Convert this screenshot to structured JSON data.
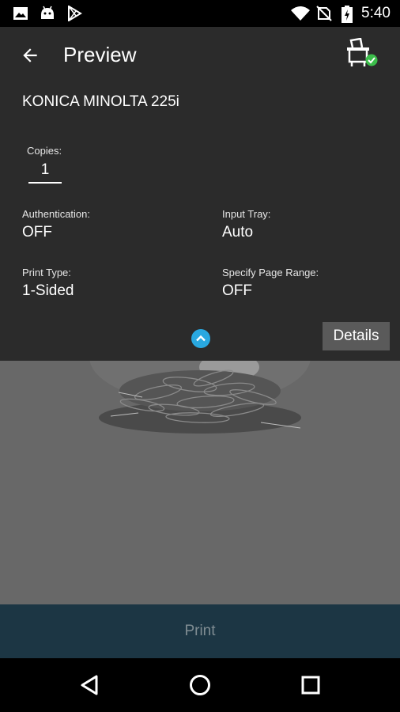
{
  "status_bar": {
    "time": "5:40",
    "icons": [
      "image-icon",
      "android-icon",
      "play-store-icon",
      "wifi-icon",
      "no-sim-icon",
      "battery-charging-icon"
    ]
  },
  "app_bar": {
    "title": "Preview",
    "back_icon": "arrow-left-icon",
    "printer_icon": "printer-connected-icon"
  },
  "settings": {
    "printer_name": "KONICA MINOLTA 225i",
    "copies": {
      "label": "Copies:",
      "value": "1"
    },
    "authentication": {
      "label": "Authentication:",
      "value": "OFF"
    },
    "input_tray": {
      "label": "Input Tray:",
      "value": "Auto"
    },
    "print_type": {
      "label": "Print Type:",
      "value": "1-Sided"
    },
    "page_range": {
      "label": "Specify Page Range:",
      "value": "OFF"
    },
    "details_label": "Details",
    "accent_color": "#29a8e0"
  },
  "print_button": {
    "label": "Print"
  },
  "nav_bar": {
    "icons": [
      "back-triangle-icon",
      "home-circle-icon",
      "recents-square-icon"
    ]
  }
}
